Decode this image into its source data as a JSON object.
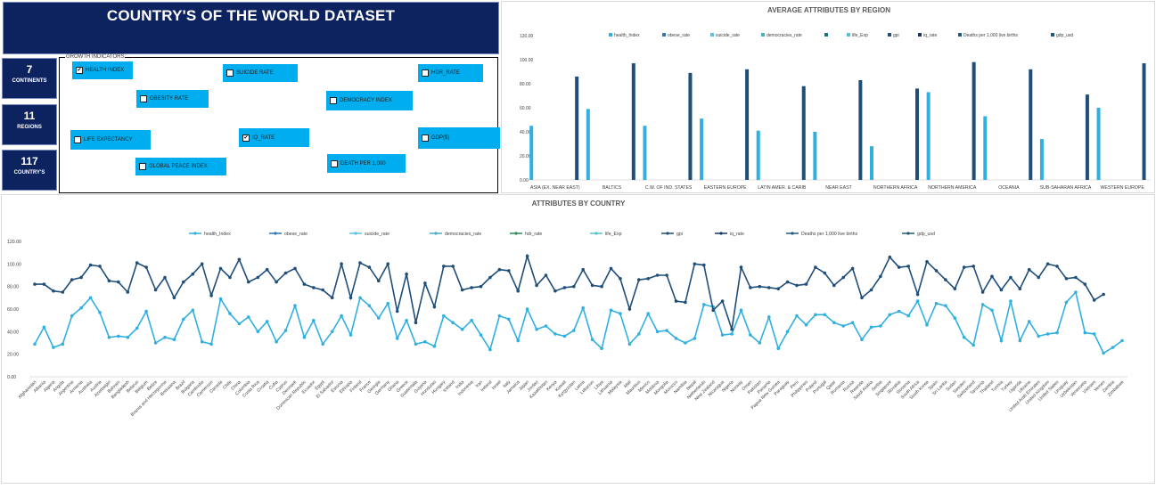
{
  "dashboard": {
    "title": "COUNTRY'S OF THE WORLD DATASET",
    "kpis": [
      {
        "value": "7",
        "label": "CONTINENTS"
      },
      {
        "value": "11",
        "label": "REGIONS"
      },
      {
        "value": "117",
        "label": "COUNTRY'S"
      }
    ],
    "growth_panel": {
      "legend": "GROWTH INDICATORS",
      "checkboxes": [
        {
          "label": "HEALTH INDEX",
          "checked": true
        },
        {
          "label": "SUICIDE RATE",
          "checked": false
        },
        {
          "label": "HDR_RATE",
          "checked": false
        },
        {
          "label": "OBESITY RATE",
          "checked": false
        },
        {
          "label": "DEMOCRACY INDEX",
          "checked": false
        },
        {
          "label": "LIFE EXPECTANCY",
          "checked": false
        },
        {
          "label": "IQ_RATE",
          "checked": true
        },
        {
          "label": "GDP($)",
          "checked": false
        },
        {
          "label": "GLOBAL PEACE INDEX",
          "checked": false
        },
        {
          "label": "DEATH PER 1,000",
          "checked": false
        }
      ]
    }
  },
  "colors": {
    "navy": "#0d2360",
    "cyan": "#00adef",
    "light_series": "#31b0e0",
    "dark_series": "#1f4e79",
    "gridline": "#d9d9d9"
  },
  "chart_data": [
    {
      "type": "bar",
      "title": "AVERAGE  ATTRIBUTES BY REGION",
      "legend": [
        "health_Index",
        "obese_rate",
        "suicide_rate",
        "democracies_rate",
        "",
        "life_Exp",
        "gpi",
        "iq_rate",
        "Deaths per 1,000 live births",
        "gdp_usd"
      ],
      "legend_colors": [
        "#31b0e0",
        "#2e75b6",
        "#5bc0e8",
        "#4bacc6",
        "#1c6e8c",
        "#56c2cf",
        "#1f4e79",
        "#17375e",
        "#1f5c7a",
        "#215a78"
      ],
      "categories": [
        "ASIA (EX. NEAR EAST)",
        "BALTICS",
        "C.W. OF IND. STATES",
        "EASTERN EUROPE",
        "LATIN AMER. & CARIB",
        "NEAR EAST",
        "NORTHERN AFRICA",
        "NORTHERN AMERICA",
        "OCEANIA",
        "SUB-SAHARAN AFRICA",
        "WESTERN EUROPE"
      ],
      "series": [
        {
          "name": "health_Index",
          "values": [
            45,
            59,
            45,
            51,
            41,
            40,
            28,
            73,
            53,
            34,
            60
          ]
        },
        {
          "name": "iq_rate",
          "values": [
            86,
            97,
            89,
            92,
            78,
            83,
            76,
            98,
            92,
            71,
            97
          ]
        }
      ],
      "yticks": [
        "0.00",
        "20.00",
        "40.00",
        "60.00",
        "80.00",
        "100.00",
        "120.00"
      ],
      "ylim": [
        0,
        120
      ]
    },
    {
      "type": "line",
      "title": "ATTRIBUTES BY COUNTRY",
      "legend": [
        "health_Index",
        "obese_rate",
        "suicide_rate",
        "democracies_rate",
        "hdr_rate",
        "life_Exp",
        "gpi",
        "iq_rate",
        "Deaths per 1,000 live births",
        "gdp_usd"
      ],
      "legend_colors": [
        "#31b0e0",
        "#2e75b6",
        "#5bc0e8",
        "#4bacc6",
        "#2e8b57",
        "#56c2cf",
        "#1f4e79",
        "#17375e",
        "#1f5c7a",
        "#215a78"
      ],
      "categories": [
        "Afghanistan",
        "Albania",
        "Algeria",
        "Angola",
        "Argentina",
        "Armenia",
        "Australia",
        "Austria",
        "Azerbaijan",
        "Bahrain",
        "Bangladesh",
        "Belarus",
        "Belgium",
        "Belize",
        "Bosnia and Herzegovina",
        "Botswana",
        "Brazil",
        "Bulgaria",
        "Cambodia",
        "Cameroon",
        "Canada",
        "Chile",
        "China",
        "Colombia",
        "Costa Rica",
        "Croatia",
        "Cuba",
        "Cyprus",
        "Denmark",
        "Dominican Republic",
        "Ecuador",
        "Egypt",
        "El Salvador",
        "Estonia",
        "Ethiopia",
        "Finland",
        "France",
        "Georgia",
        "Germany",
        "Ghana",
        "Greece",
        "Guatemala",
        "Guyana",
        "Honduras",
        "Hungary",
        "Iceland",
        "India",
        "Indonesia",
        "Iran",
        "Ireland",
        "Italy",
        "Jamaica",
        "Japan",
        "Jordan",
        "Kazakhstan",
        "Kenya",
        "Kuwait",
        "Kyrgyzstan",
        "Latvia",
        "Lebanon",
        "Libya",
        "Lithuania",
        "Malaysia",
        "Mali",
        "Mauritius",
        "Mexico",
        "Moldova",
        "Mongolia",
        "Morocco",
        "Namibia",
        "Nepal",
        "Netherlands",
        "New Zealand",
        "Nicaragua",
        "Nigeria",
        "Norway",
        "Oman",
        "Pakistan",
        "Panama",
        "Papua New Guinea",
        "Paraguay",
        "Peru",
        "Philippines",
        "Poland",
        "Portugal",
        "Qatar",
        "Romania",
        "Russia",
        "Rwanda",
        "Saudi Arabia",
        "Serbia",
        "Singapore",
        "Slovakia",
        "Slovenia",
        "South Africa",
        "South Korea",
        "Spain",
        "Sri Lanka",
        "Sudan",
        "Sweden",
        "Switzerland",
        "Tanzania",
        "Thailand",
        "Tunisia",
        "Turkey",
        "Uganda",
        "Ukraine",
        "United Arab Emirates",
        "United Kingdom",
        "United States",
        "Uruguay",
        "Uzbekistan",
        "Venezuela",
        "Vietnam",
        "Yemen",
        "Zambia",
        "Zimbabwe"
      ],
      "tick_labels": [
        "Afghanistan",
        "Albania",
        "Algeria",
        "Angola",
        "Argentina",
        "Armenia",
        "Australia",
        "Austria",
        "Azerbaijan",
        "Bahrain",
        "Bangladesh",
        "Belarus",
        "Belgium",
        "Belize",
        "Bosnia and Herzegovina",
        "Botswana",
        "Brazil",
        "Bulgaria",
        "Cambodia",
        "Cameroon",
        "Canada",
        "Chile",
        "China",
        "Colombia",
        "Costa Rica",
        "Croatia",
        "Cuba",
        "Cyprus",
        "Denmark",
        "Dominican Republic",
        "Ecuador",
        "Egypt",
        "El Salvador",
        "Estonia",
        "Ethiopia",
        "Finland",
        "France",
        "Georgia",
        "Germany",
        "Ghana",
        "Greece",
        "Guatemala",
        "Guyana",
        "Honduras",
        "Hungary",
        "Iceland",
        "India",
        "Indonesia",
        "Iran",
        "Ireland",
        "Israel",
        "Italy",
        "Jamaica",
        "Japan",
        "Jordan",
        "Kazakhstan",
        "Kenya",
        "Kuwait",
        "Kyrgyzstan",
        "Latvia",
        "Lebanon",
        "Libya",
        "Lithuania",
        "Malaysia",
        "Mali",
        "Mauritius",
        "Mexico",
        "Moldova",
        "Mongolia",
        "Morocco",
        "Namibia",
        "Nepal",
        "Netherlands",
        "New Zealand",
        "Nicaragua",
        "Nigeria",
        "Norway",
        "Oman",
        "Pakistan",
        "Panama",
        "Papua New Guinea",
        "Paraguay",
        "Peru",
        "Philippines",
        "Poland",
        "Portugal",
        "Qatar",
        "Romania",
        "Russia",
        "Rwanda",
        "Saudi Arabia",
        "Serbia",
        "Singapore",
        "Slovakia",
        "Slovenia",
        "South Africa",
        "South Korea",
        "Spain",
        "Sri Lanka",
        "Sudan",
        "Sweden",
        "Switzerland",
        "Tanzania",
        "Thailand",
        "Tunisia",
        "Turkey",
        "Uganda",
        "Ukraine",
        "United Arab Emirates",
        "United Kingdom",
        "United States",
        "Uruguay",
        "Uzbekistan",
        "Venezuela",
        "Vietnam",
        "Yemen",
        "Zambia",
        "Zimbabwe"
      ],
      "series": [
        {
          "name": "health_Index",
          "values": [
            29,
            44,
            26,
            29,
            54,
            61,
            70,
            57,
            35,
            36,
            35,
            43,
            58,
            30,
            35,
            33,
            51,
            59,
            31,
            29,
            69,
            56,
            47,
            53,
            40,
            49,
            31,
            41,
            63,
            35,
            50,
            29,
            40,
            54,
            37,
            70,
            63,
            52,
            65,
            34,
            50,
            29,
            31,
            27,
            54,
            48,
            42,
            50,
            37,
            24,
            54,
            51,
            32,
            60,
            42,
            45,
            38,
            36,
            41,
            61,
            33,
            25,
            59,
            56,
            29,
            38,
            56,
            40,
            41,
            34,
            30,
            34,
            64,
            62,
            37,
            38,
            59,
            37,
            30,
            53,
            25,
            40,
            54,
            46,
            55,
            55,
            48,
            45,
            48,
            33,
            44,
            45,
            55,
            58,
            54,
            67,
            46,
            65,
            63,
            52,
            35,
            28,
            64,
            59,
            32,
            67,
            32,
            49,
            36,
            38,
            39,
            66,
            75,
            39,
            38,
            21,
            26,
            32
          ]
        },
        {
          "name": "iq_rate",
          "values": [
            82,
            82,
            76,
            75,
            86,
            88,
            99,
            98,
            85,
            84,
            75,
            101,
            97,
            77,
            88,
            70,
            84,
            91,
            100,
            72,
            96,
            88,
            104,
            84,
            88,
            95,
            84,
            92,
            96,
            82,
            79,
            77,
            70,
            100,
            70,
            101,
            97,
            85,
            100,
            58,
            91,
            48,
            83,
            62,
            98,
            98,
            77,
            79,
            80,
            88,
            95,
            94,
            76,
            107,
            81,
            90,
            76,
            79,
            80,
            95,
            81,
            80,
            96,
            87,
            60,
            86,
            87,
            90,
            90,
            67,
            66,
            100,
            99,
            59,
            67,
            42,
            97,
            79,
            80,
            79,
            78,
            84,
            81,
            82,
            97,
            92,
            81,
            88,
            96,
            70,
            77,
            89,
            106,
            97,
            98,
            73,
            102,
            94,
            86,
            78,
            97,
            98,
            75,
            89,
            77,
            88,
            78,
            95,
            88,
            100,
            98,
            87,
            88,
            82,
            68,
            73
          ]
        }
      ],
      "yticks": [
        "0.00",
        "20.00",
        "40.00",
        "60.00",
        "80.00",
        "100.00",
        "120.00"
      ],
      "ylim": [
        0,
        120
      ]
    }
  ]
}
